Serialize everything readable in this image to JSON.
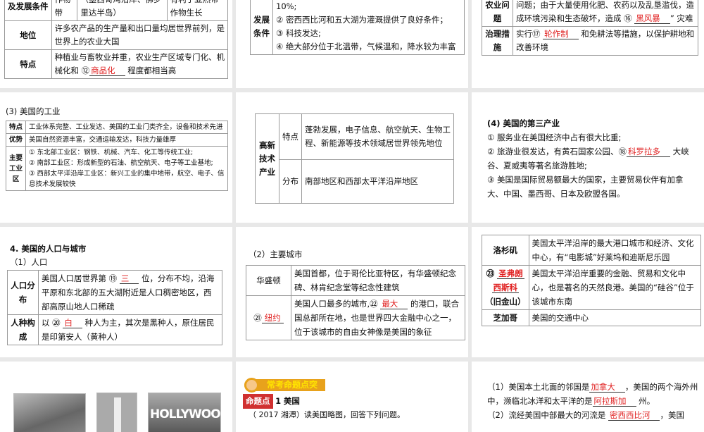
{
  "s1": {
    "r0": [
      "及发展条件",
      "作物带",
      "（墨西哥湾沿岸、佛罗里达半岛）",
      "有利于亚热带作物生长"
    ],
    "r1h": "地位",
    "r1": "许多农产品的生产量和出口量均居世界前列，是世界上的农业大国",
    "r2h": "特点",
    "r2a": "种植业与畜牧业并重，农业生产区域专门化、机械化和 ⑫",
    "r2ans": "商品化",
    "r2b": " 程度都相当高"
  },
  "s2": {
    "h": "发展条件",
    "lines": [
      "10%;",
      "② 密西西比河和五大湖为灌溉提供了良好条件；",
      "③ 科技发达;",
      "④ 绝大部分位于北温带，气候温和，降水较为丰富"
    ]
  },
  "s3": {
    "r0h": "农业问题",
    "r0a": "问题；由于大量使用化肥、农药以及乱垦滥伐，造成环境污染和生态破坏，造成 ⑯ ",
    "r0ans": "黑风暴",
    "r0b": "” 灾难",
    "r1h": "治理措施",
    "r1a": "实行⑰ ",
    "r1ans": "轮作制",
    "r1b": " 和免耕法等措施，以保护耕地和改善环境"
  },
  "s4": {
    "title": "(3) 美国的工业",
    "rows": [
      {
        "h": "特点",
        "v": "工业体系完整、工业发达、美国的工业门类齐全，设备和技术先进"
      },
      {
        "h": "优势",
        "v": "美国自然资源丰富，交通运输发达，科技力量雄厚"
      },
      {
        "h": "主要工业区",
        "v1": "① 东北部工业区：钢铁、机械、汽车、化工等传统工业;",
        "v2": "② 南部工业区：形成新型的石油、航空航天、电子等工业基地;",
        "v3": "③ 西部太平洋沿岸工业区：新兴工业的集中地带，航空、电子、信息技术发展较快"
      }
    ]
  },
  "s5": {
    "h": "高新技术产业",
    "r0h": "特点",
    "r0": "蓬勃发展，电子信息、航空航天、生物工程、新能源等技术领域居世界领先地位",
    "r1h": "分布",
    "r1": "南部地区和西部太平洋沿岸地区"
  },
  "s6": {
    "title": "(4) 美国的第三产业",
    "l1": "① 服务业在美国经济中占有很大比重;",
    "l2a": "② 旅游业很发达，有黄石国家公园、⑱",
    "l2ans": "科罗拉多",
    "l2b": " 大峡谷、夏威夷等著名旅游胜地;",
    "l3": "③ 美国是国际贸易额最大的国家，主要贸易伙伴有加拿大、中国、墨西哥、日本及欧盟各国。"
  },
  "s7": {
    "title": "4. 美国的人口与城市",
    "sub": "（1）人口",
    "r0h": "人口分布",
    "r0a": "美国人口居世界第 ⑲ ",
    "r0ans": "三",
    "r0b": " 位，分布不均，沿海平原和东北部的五大湖附近是人口稠密地区，西部高原山地人口稀疏",
    "r1h": "人种构成",
    "r1a": "以 ⑳ ",
    "r1ans": "白",
    "r1b": " 种人为主，其次是黑种人，原住居民是印第安人（黄种人）"
  },
  "s8": {
    "title": "（2）主要城市",
    "r0h": "华盛顿",
    "r0": "美国首都，位于哥伦比亚特区，有华盛顿纪念碑、林肯纪念堂等纪念性建筑",
    "r1hn": "㉑",
    "r1hans": "纽约",
    "r1a": "美国人口最多的城市,㉒ ",
    "r1ans": "最大",
    "r1b": " 的港口，联合国总部所在地，也是世界四大金融中心之一，位于该城市的自由女神像是美国的象征"
  },
  "s9": {
    "r0h": "洛杉矶",
    "r0": "美国太平洋沿岸的最大港口城市和经济、文化中心，有“电影城”好莱坞和迪斯尼乐园",
    "r1hn": "㉓",
    "r1ans1": "圣弗朗",
    "r1ans2": "西斯科",
    "r1hsub": "（旧金山）",
    "r1": "美国太平洋沿岸重要的金融、贸易和文化中心，也是著名的天然良港。美国的“硅谷”位于该城市东南",
    "r2h": "芝加哥",
    "r2": "美国的交通中心"
  },
  "s10": {
    "img3": "HOLLYWOOD"
  },
  "s11": {
    "banner": "常考命题点突",
    "tag": "命题点",
    "num": "1",
    "topic": "美国",
    "q": "（ 2017 湘潭）读美国略图，回答下列问题。"
  },
  "s12": {
    "q1a": "（1）美国本土北面的邻国是",
    "q1ans": "加拿大",
    "q1b": "，美国的两个海外州中，濒临北冰洋和太平洋的是",
    "q1ans2": "阿拉斯加",
    "q1c": " 州。",
    "q2a": "（2）流经美国中部最大的河流是 ",
    "q2ans": "密西西比河",
    "q2b": "，美国"
  }
}
